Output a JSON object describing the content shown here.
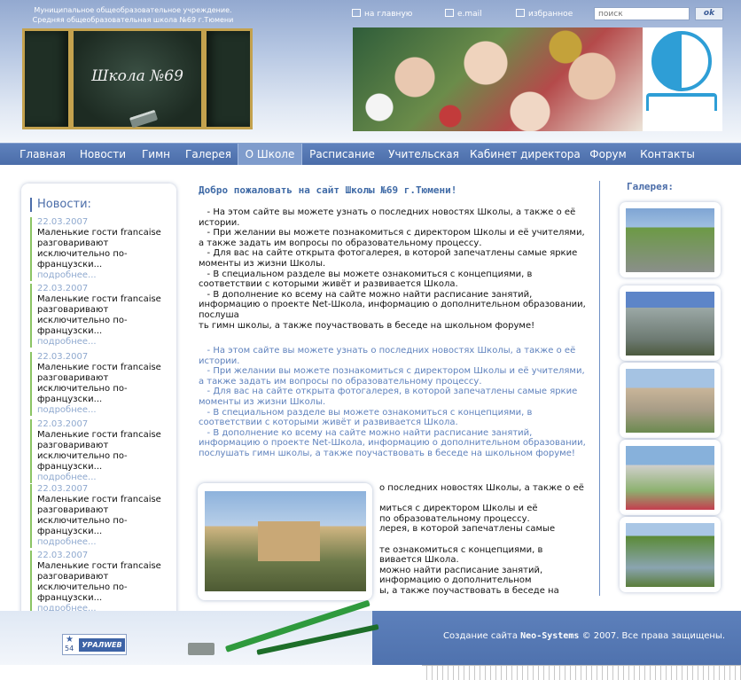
{
  "header": {
    "org_line1": "Муниципальное общеобразовательное учреждение.",
    "org_line2": "Средняя общеобразовательная школа №69 г.Тюмени",
    "board_title": "Школа №69",
    "top_links": [
      {
        "label": "на главную",
        "icon": "home-icon"
      },
      {
        "label": "e.mail",
        "icon": "mail-icon"
      },
      {
        "label": "избранное",
        "icon": "bookmark-icon"
      }
    ],
    "search_placeholder": "поиск",
    "search_button": "ok"
  },
  "nav": {
    "items": [
      {
        "label": "Главная"
      },
      {
        "label": "Новости"
      },
      {
        "label": "Гимн"
      },
      {
        "label": "Галерея"
      },
      {
        "label": "О Школе",
        "active": true
      },
      {
        "label": "Расписание"
      },
      {
        "label": "Учительская"
      },
      {
        "label": "Кабинет директора"
      },
      {
        "label": "Форум"
      },
      {
        "label": "Контакты"
      }
    ]
  },
  "news": {
    "title": "Новости:",
    "items": [
      {
        "date": "22.03.2007",
        "text": "Маленькие гости francaise разговаривают исключительно по-французски...",
        "more": "подробнее..."
      },
      {
        "date": "22.03.2007",
        "text": "Маленькие гости francaise разговаривают исключительно по-французски...",
        "more": "подробнее..."
      },
      {
        "date": "22.03.2007",
        "text": "Маленькие гости francaise разговаривают исключительно по-французски...",
        "more": "подробнее..."
      },
      {
        "date": "22.03.2007",
        "text": "Маленькие гости francaise разговаривают исключительно по-французски...",
        "more": "подробнее..."
      },
      {
        "date": "22.03.2007",
        "text": "Маленькие гости francaise разговаривают исключительно по-французски...",
        "more": "подробнее..."
      },
      {
        "date": "22.03.2007",
        "text": "Маленькие гости francaise разговаривают исключительно по-французски...",
        "more": "подробнее..."
      }
    ]
  },
  "main": {
    "welcome": "Добро пожаловать на сайт Школы №69 г.Тюмени!",
    "paragraph_black": "   - На этом сайте вы можете узнать о последних новостях Школы, а также о её истории.\n   - При желании вы можете познакомиться с директором Школы и её учителями, а также задать им вопросы по образовательному процессу.\n   - Для вас на сайте открыта фотогалерея, в которой запечатлены самые яркие моменты из жизни Школы.\n   - В специальном разделе вы можете ознакомиться с концепциями, в соответствии с которыми живёт и развивается Школа.\n   - В дополнение ко всему на сайте можно найти расписание занятий, информацию о проекте Net-Школа, информацию о дополнительном образовании, послуша\nть гимн школы, а также поучаствовать в беседе на школьном форуме!",
    "paragraph_blue": "   - На этом сайте вы можете узнать о последних новостях Школы, а также о её истории.\n   - При желании вы можете познакомиться с директором Школы и её учителями, а также задать им вопросы по образовательному процессу.\n   - Для вас на сайте открыта фотогалерея, в которой запечатлены самые яркие моменты из жизни Школы.\n   - В специальном разделе вы можете ознакомиться с концепциями, в соответствии с которыми живёт и развивается Школа.\n   - В дополнение ко всему на сайте можно найти расписание занятий, информацию о проекте Net-Школа, информацию о дополнительном образовании, послушать гимн школы, а также поучаствовать в беседе на школьном форуме!",
    "paragraph_wrapped": "о последних новостях Школы, а также о её\n\nмиться с директором Школы и её\nпо образовательному процессу.\nлерея, в которой запечатлены самые\n\nте ознакомиться с концепциями, в\nвивается Школа.\nможно найти расписание занятий,\nинформацию о дополнительном\nы, а также поучаствовать в беседе на"
  },
  "gallery": {
    "title": "Галерея:"
  },
  "footer": {
    "counter_number": "54",
    "counter_brand": "УРАЛWEB",
    "copyright_prefix": "Создание сайта",
    "copyright_company": "Neo-Systems",
    "copyright_suffix": "© 2007. Все права защищены."
  },
  "colors": {
    "accent": "#4b6da9",
    "nav_bg": "#5577b4",
    "news_line": "#8bc464",
    "link_light": "#8fa9cf"
  }
}
